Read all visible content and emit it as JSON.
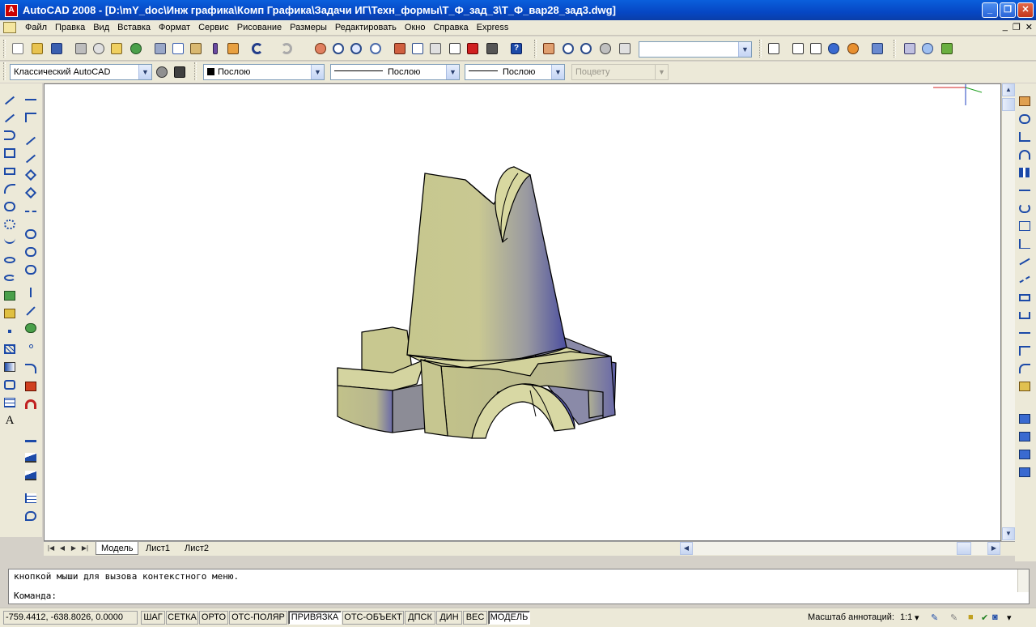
{
  "window": {
    "title": "AutoCAD 2008 - [D:\\mY_doc\\Инж графика\\Комп Графика\\Задачи ИГ\\Техн_формы\\Т_Ф_зад_3\\Т_Ф_вар28_зад3.dwg]",
    "app_icon": "A",
    "buttons": [
      "_",
      "❐",
      "✕"
    ]
  },
  "menu": {
    "items": [
      "Файл",
      "Правка",
      "Вид",
      "Вставка",
      "Формат",
      "Сервис",
      "Рисование",
      "Размеры",
      "Редактировать",
      "Окно",
      "Справка",
      "Express"
    ],
    "doc_buttons": [
      "_",
      "❐",
      "✕"
    ]
  },
  "toolbar": {
    "workspace": "Классический AutoCAD",
    "color": "Послою",
    "linetype": "Послою",
    "lineweight": "Послою",
    "plotstyle": "Поцвету",
    "view_combo": ""
  },
  "tabs": [
    "Модель",
    "Лист1",
    "Лист2"
  ],
  "command": {
    "history": "кнопкой мыши для вызова контекстного меню.",
    "prompt": "Команда:"
  },
  "status": {
    "coords": "-759.4412, -638.8026, 0.0000",
    "buttons": [
      {
        "label": "ШАГ",
        "on": false
      },
      {
        "label": "СЕТКА",
        "on": false
      },
      {
        "label": "ОРТО",
        "on": false
      },
      {
        "label": "ОТС-ПОЛЯР",
        "on": false
      },
      {
        "label": "ПРИВЯЗКА",
        "on": true
      },
      {
        "label": "ОТС-ОБЪЕКТ",
        "on": false
      },
      {
        "label": "ДПСК",
        "on": false
      },
      {
        "label": "ДИН",
        "on": false
      },
      {
        "label": "ВЕС",
        "on": false
      },
      {
        "label": "МОДЕЛЬ",
        "on": true
      }
    ],
    "annotation_scale_label": "Масштаб аннотаций:",
    "annotation_scale_value": "1:1"
  },
  "icons": {
    "toolbar": [
      "new-icon",
      "open-icon",
      "save-icon",
      "plot-icon",
      "preview-icon",
      "publish-icon",
      "3d-dwf-icon",
      "cut-icon",
      "copy-icon",
      "paste-icon",
      "match-properties-icon",
      "block-editor-icon",
      "undo-icon",
      "redo-icon",
      "pan-icon",
      "zoom-realtime-icon",
      "zoom-window-icon",
      "zoom-previous-icon",
      "properties-icon",
      "design-center-icon",
      "tool-palettes-icon",
      "sheet-set-icon",
      "markup-icon",
      "calculator-icon",
      "help-icon"
    ],
    "colors": {
      "accent": "#0a5fdc",
      "model": "#c9c892",
      "shade": "#5f5fa0"
    }
  }
}
